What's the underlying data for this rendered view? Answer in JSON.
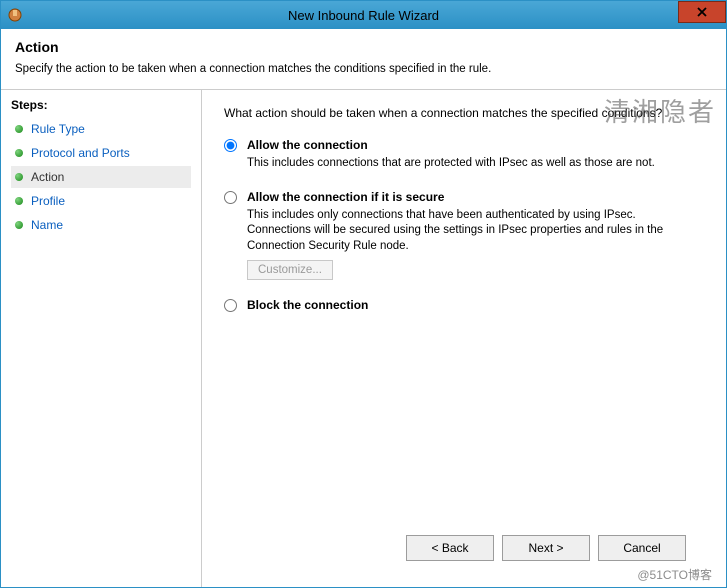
{
  "titlebar": {
    "title": "New Inbound Rule Wizard"
  },
  "header": {
    "title": "Action",
    "subtitle": "Specify the action to be taken when a connection matches the conditions specified in the rule."
  },
  "sidebar": {
    "heading": "Steps:",
    "items": [
      {
        "label": "Rule Type"
      },
      {
        "label": "Protocol and Ports"
      },
      {
        "label": "Action"
      },
      {
        "label": "Profile"
      },
      {
        "label": "Name"
      }
    ]
  },
  "main": {
    "prompt": "What action should be taken when a connection matches the specified conditions?",
    "options": {
      "allow": {
        "label": "Allow the connection",
        "desc": "This includes connections that are protected with IPsec as well as those are not."
      },
      "allow_secure": {
        "label": "Allow the connection if it is secure",
        "desc": "This includes only connections that have been authenticated by using IPsec.  Connections will be secured using the settings in IPsec properties and rules in the Connection Security Rule node.",
        "customize": "Customize..."
      },
      "block": {
        "label": "Block the connection"
      }
    }
  },
  "footer": {
    "back": "< Back",
    "next": "Next >",
    "cancel": "Cancel"
  },
  "watermark": {
    "top": "清湘隐者",
    "bottom": "@51CTO博客"
  }
}
